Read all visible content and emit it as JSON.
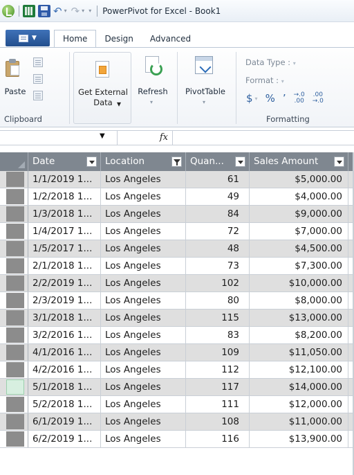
{
  "window": {
    "title": "PowerPivot for Excel - Book1"
  },
  "quick_access": {
    "undo_glyph": "↶",
    "redo_glyph": "↷",
    "customize_glyph": "▾"
  },
  "ribbon_tabs": [
    {
      "label": "Home",
      "active": true
    },
    {
      "label": "Design",
      "active": false
    },
    {
      "label": "Advanced",
      "active": false
    }
  ],
  "ribbon": {
    "paste_label": "Paste",
    "get_external_data_label": "Get External Data",
    "refresh_label": "Refresh",
    "pivottable_label": "PivotTable",
    "clipboard_group": "Clipboard",
    "data_type_label": "Data Type :",
    "format_label": "Format :",
    "formatting_group": "Formatting",
    "currency_symbol": "$",
    "percent_symbol": "%",
    "comma_symbol": "’",
    "increase_decimal": "→.0 .00",
    "decrease_decimal": ".00 →.0"
  },
  "formula_bar": {
    "name_box_value": "",
    "fx_label": "fx",
    "formula_value": ""
  },
  "table": {
    "columns": [
      {
        "header": "Date",
        "filter_icon": "dropdown-arrow"
      },
      {
        "header": "Location",
        "filter_icon": "filter-active"
      },
      {
        "header": "Quan...",
        "filter_icon": "dropdown-arrow"
      },
      {
        "header": "Sales Amount",
        "filter_icon": "dropdown-arrow"
      }
    ],
    "rows": [
      {
        "date": "1/1/2019 1...",
        "location": "Los Angeles",
        "quantity": "61",
        "sales": "$5,000.00"
      },
      {
        "date": "1/2/2018 1...",
        "location": "Los Angeles",
        "quantity": "49",
        "sales": "$4,000.00"
      },
      {
        "date": "1/3/2018 1...",
        "location": "Los Angeles",
        "quantity": "84",
        "sales": "$9,000.00"
      },
      {
        "date": "1/4/2017 1...",
        "location": "Los Angeles",
        "quantity": "72",
        "sales": "$7,000.00"
      },
      {
        "date": "1/5/2017 1...",
        "location": "Los Angeles",
        "quantity": "48",
        "sales": "$4,500.00"
      },
      {
        "date": "2/1/2018 1...",
        "location": "Los Angeles",
        "quantity": "73",
        "sales": "$7,300.00"
      },
      {
        "date": "2/2/2019 1...",
        "location": "Los Angeles",
        "quantity": "102",
        "sales": "$10,000.00"
      },
      {
        "date": "2/3/2019 1...",
        "location": "Los Angeles",
        "quantity": "80",
        "sales": "$8,000.00"
      },
      {
        "date": "3/1/2018 1...",
        "location": "Los Angeles",
        "quantity": "115",
        "sales": "$13,000.00"
      },
      {
        "date": "3/2/2016 1...",
        "location": "Los Angeles",
        "quantity": "83",
        "sales": "$8,200.00"
      },
      {
        "date": "4/1/2016 1...",
        "location": "Los Angeles",
        "quantity": "109",
        "sales": "$11,050.00"
      },
      {
        "date": "4/2/2016 1...",
        "location": "Los Angeles",
        "quantity": "112",
        "sales": "$12,100.00"
      },
      {
        "date": "5/1/2018 1...",
        "location": "Los Angeles",
        "quantity": "117",
        "sales": "$14,000.00"
      },
      {
        "date": "5/2/2018 1...",
        "location": "Los Angeles",
        "quantity": "111",
        "sales": "$12,000.00"
      },
      {
        "date": "6/1/2019 1...",
        "location": "Los Angeles",
        "quantity": "108",
        "sales": "$11,000.00"
      },
      {
        "date": "6/2/2019 1...",
        "location": "Los Angeles",
        "quantity": "116",
        "sales": "$13,900.00"
      }
    ],
    "selected_row_index": 12
  },
  "colors": {
    "header_bg": "#7f8790",
    "alt_row_bg": "#dfdfdf",
    "row_header_block": "#8c8c8c",
    "selected_row_header": "#d7efe0"
  }
}
